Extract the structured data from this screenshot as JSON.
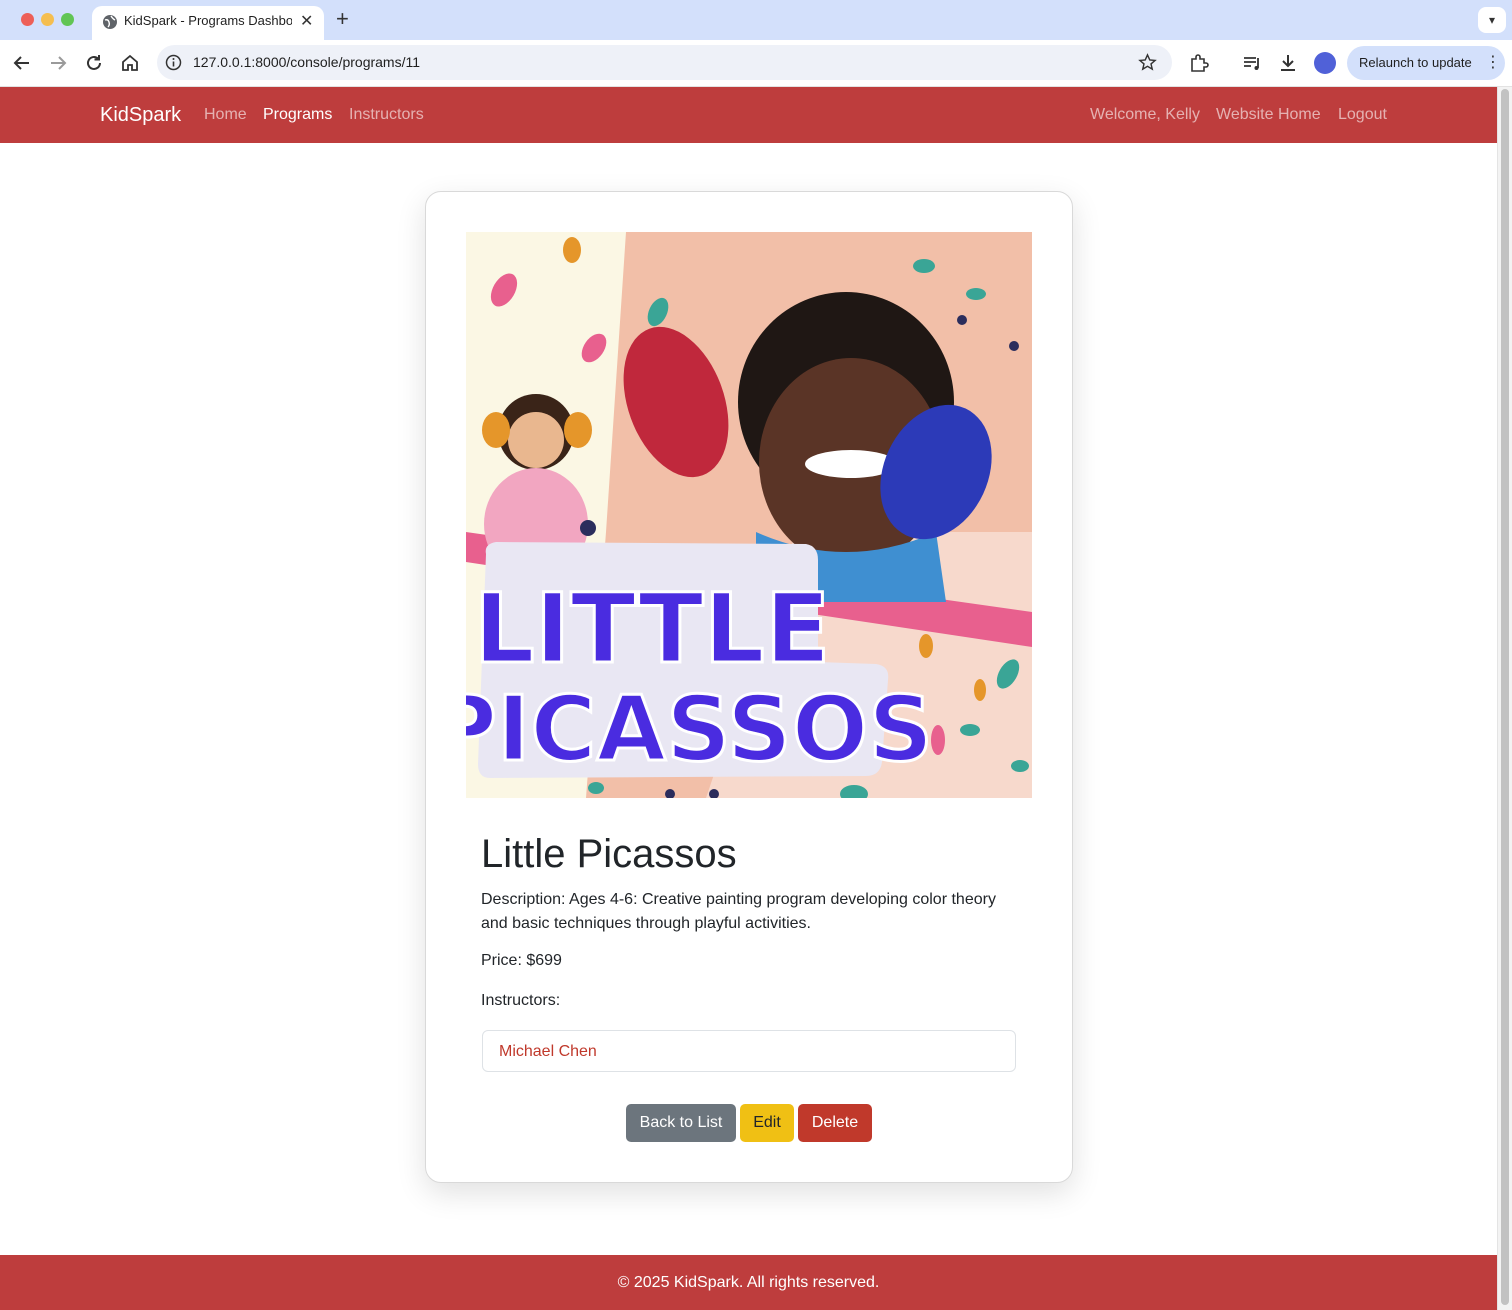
{
  "browser": {
    "tab_title": "KidSpark - Programs Dashboard",
    "url": "127.0.0.1:8000/console/programs/11",
    "relaunch_label": "Relaunch to update"
  },
  "navbar": {
    "brand": "KidSpark",
    "links": [
      "Home",
      "Programs",
      "Instructors"
    ],
    "active_link": "Programs",
    "right": {
      "welcome": "Welcome, Kelly",
      "website_home": "Website Home",
      "logout": "Logout"
    }
  },
  "program": {
    "image_text": "LITTLE PICASSOS",
    "title": "Little Picassos",
    "description": "Description: Ages 4-6: Creative painting program developing color theory and basic techniques through playful activities.",
    "price": "Price: $699",
    "instructors_label": "Instructors:",
    "instructors": [
      "Michael Chen"
    ]
  },
  "actions": {
    "back": "Back to List",
    "edit": "Edit",
    "delete": "Delete"
  },
  "footer": {
    "text": "© 2025 KidSpark. All rights reserved."
  },
  "colors": {
    "brand_red": "#be3d3d",
    "link_red": "#c0392b",
    "edit_yellow": "#f0c014",
    "secondary_gray": "#6c757d"
  }
}
